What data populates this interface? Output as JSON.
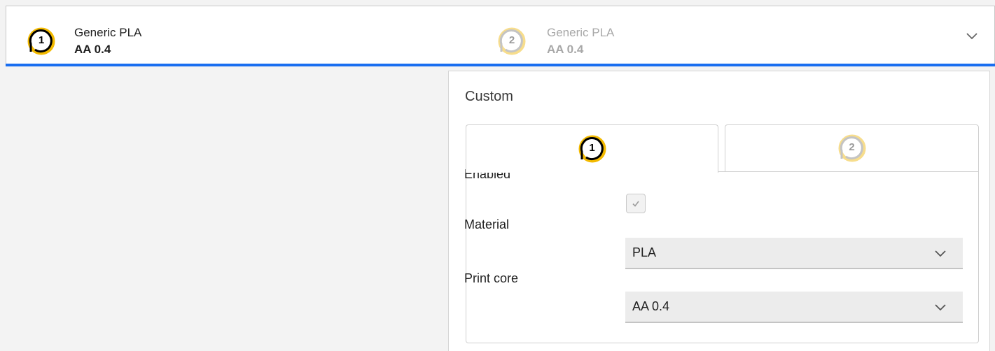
{
  "header": {
    "extruders": [
      {
        "number": "1",
        "material": "Generic PLA",
        "core": "AA 0.4",
        "enabled": true
      },
      {
        "number": "2",
        "material": "Generic PLA",
        "core": "AA 0.4",
        "enabled": false
      }
    ],
    "expand_icon": "chevron-down-icon"
  },
  "panel": {
    "title": "Custom",
    "tabs": [
      {
        "number": "1",
        "active": true
      },
      {
        "number": "2",
        "active": false
      }
    ],
    "fields": {
      "enabled_label": "Enabled",
      "enabled_checked": true,
      "material_label": "Material",
      "material_value": "PLA",
      "core_label": "Print core",
      "core_value": "AA 0.4"
    }
  },
  "colors": {
    "accent_blue": "#196ef0",
    "badge_yellow": "#f3ba00",
    "badge_yellow_faded": "#f7dd8c"
  }
}
